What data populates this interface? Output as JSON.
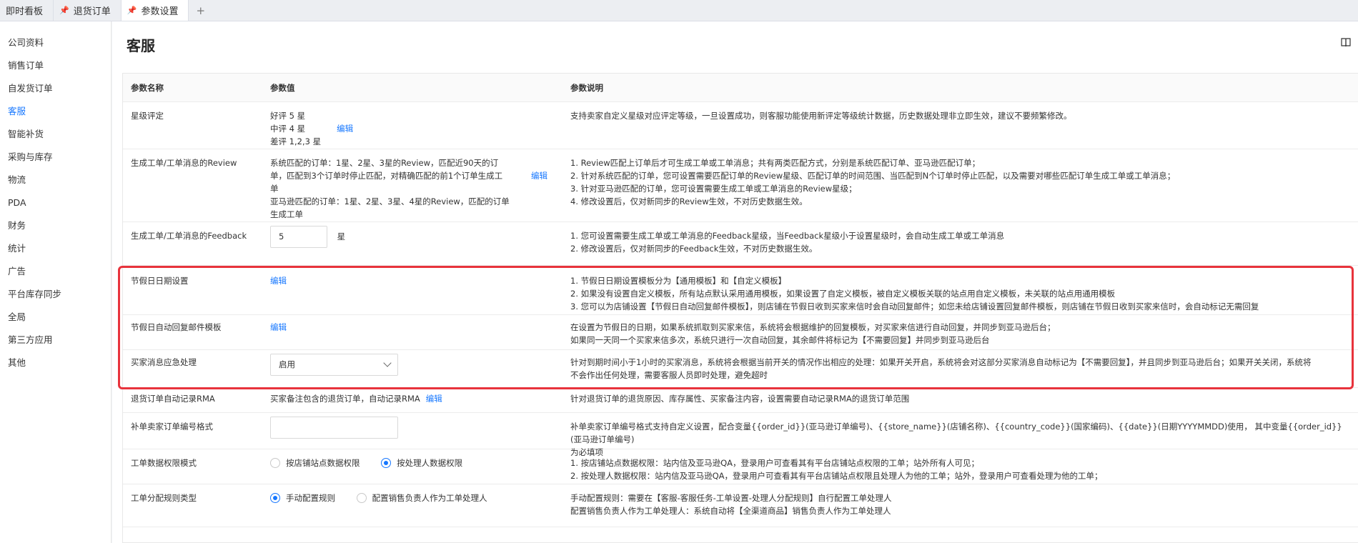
{
  "tabs": [
    {
      "label": "即时看板",
      "pinned": false,
      "active": false
    },
    {
      "label": "退货订单",
      "pinned": true,
      "active": false
    },
    {
      "label": "参数设置",
      "pinned": true,
      "active": true
    }
  ],
  "tab_add": "+",
  "sidebar": {
    "items": [
      {
        "label": "公司资料"
      },
      {
        "label": "销售订单"
      },
      {
        "label": "自发货订单"
      },
      {
        "label": "客服",
        "active": true
      },
      {
        "label": "智能补货"
      },
      {
        "label": "采购与库存"
      },
      {
        "label": "物流"
      },
      {
        "label": "PDA"
      },
      {
        "label": "财务"
      },
      {
        "label": "统计"
      },
      {
        "label": "广告"
      },
      {
        "label": "平台库存同步"
      },
      {
        "label": "全局"
      },
      {
        "label": "第三方应用"
      },
      {
        "label": "其他"
      }
    ]
  },
  "page": {
    "title": "客服"
  },
  "table": {
    "headers": {
      "name": "参数名称",
      "value": "参数值",
      "desc": "参数说明"
    },
    "rows": {
      "r1": {
        "name": "星级评定",
        "value_lines": [
          "好评 5 星",
          "中评 4 星",
          "差评 1,2,3 星"
        ],
        "link": "编辑",
        "desc": "支持卖家自定义星级对应评定等级，一旦设置成功，则客服功能使用新评定等级统计数据，历史数据处理非立即生效，建议不要频繁修改。"
      },
      "r2": {
        "name": "生成工单/工单消息的Review",
        "value_lines": [
          "系统匹配的订单：1星、2星、3星的Review，匹配近90天的订",
          "单，匹配到3个订单时停止匹配，对精确匹配的前1个订单生成工",
          "单",
          "亚马逊匹配的订单：1星、2星、3星、4星的Review，匹配的订单",
          "生成工单"
        ],
        "link": "编辑",
        "desc_lines": [
          "1. Review匹配上订单后才可生成工单或工单消息；共有两类匹配方式，分别是系统匹配订单、亚马逊匹配订单；",
          "2. 针对系统匹配的订单，您可设置需要匹配订单的Review星级、匹配订单的时间范围、当匹配到N个订单时停止匹配，以及需要对哪些匹配订单生成工单或工单消息；",
          "3. 针对亚马逊匹配的订单，您可设置需要生成工单或工单消息的Review星级；",
          "4. 修改设置后，仅对新同步的Review生效，不对历史数据生效。"
        ]
      },
      "r3": {
        "name": "生成工单/工单消息的Feedback",
        "input_value": "5",
        "unit": "星",
        "desc_lines": [
          "1. 您可设置需要生成工单或工单消息的Feedback星级，当Feedback星级小于设置星级时，会自动生成工单或工单消息",
          "2. 修改设置后，仅对新同步的Feedback生效，不对历史数据生效。"
        ]
      },
      "r4": {
        "name": "节假日日期设置",
        "link": "编辑",
        "desc_lines": [
          "1. 节假日日期设置模板分为【通用模板】和【自定义模板】",
          "2. 如果没有设置自定义模板，所有站点默认采用通用模板，如果设置了自定义模板，被自定义模板关联的站点用自定义模板，未关联的站点用通用模板",
          "3. 您可以为店铺设置【节假日自动回复邮件模板】，则店铺在节假日收到买家来信时会自动回复邮件；如您未给店铺设置回复邮件模板，则店铺在节假日收到买家来信时，会自动标记无需回复"
        ]
      },
      "r5": {
        "name": "节假日自动回复邮件模板",
        "link": "编辑",
        "desc_lines": [
          "在设置为节假日的日期，如果系统抓取到买家来信，系统将会根据维护的回复模板，对买家来信进行自动回复，并同步到亚马逊后台；",
          "如果同一天同一个买家来信多次，系统只进行一次自动回复，其余邮件将标记为【不需要回复】并同步到亚马逊后台"
        ]
      },
      "r6": {
        "name": "买家消息应急处理",
        "select_value": "启用",
        "desc_lines": [
          "针对到期时间小于1小时的买家消息，系统将会根据当前开关的情况作出相应的处理：如果开关开启，系统将会对这部分买家消息自动标记为【不需要回复】，并且同步到亚马逊后台；如果开关关闭，系统将",
          "不会作出任何处理，需要客服人员即时处理，避免超时"
        ]
      },
      "r7": {
        "name": "退货订单自动记录RMA",
        "value_text": "买家备注包含的退货订单，自动记录RMA",
        "link": "编辑",
        "desc": "针对退货订单的退货原因、库存属性、买家备注内容，设置需要自动记录RMA的退货订单范围"
      },
      "r8": {
        "name": "补单卖家订单编号格式",
        "input_value": "",
        "desc_lines": [
          "补单卖家订单编号格式支持自定义设置，配合变量{{order_id}}(亚马逊订单编号)、{{store_name}}(店铺名称)、{{country_code}}(国家编码)、{{date}}(日期YYYYMMDD)使用， 其中变量{{order_id}}(亚马逊订单编号)",
          "为必填项"
        ]
      },
      "r9": {
        "name": "工单数据权限模式",
        "options": [
          {
            "label": "按店铺站点数据权限",
            "checked": false
          },
          {
            "label": "按处理人数据权限",
            "checked": true
          }
        ],
        "desc_lines": [
          "1. 按店铺站点数据权限：站内信及亚马逊QA，登录用户可查看其有平台店铺站点权限的工单；站外所有人可见；",
          "2. 按处理人数据权限：站内信及亚马逊QA，登录用户可查看其有平台店铺站点权限且处理人为他的工单；站外，登录用户可查看处理为他的工单；"
        ]
      },
      "r10": {
        "name": "工单分配规则类型",
        "options": [
          {
            "label": "手动配置规则",
            "checked": true
          },
          {
            "label": "配置销售负责人作为工单处理人",
            "checked": false
          }
        ],
        "desc_lines": [
          "手动配置规则：需要在【客服-客服任务-工单设置-处理人分配规则】自行配置工单处理人",
          "配置销售负责人作为工单处理人：系统自动将【全渠道商品】销售负责人作为工单处理人"
        ]
      }
    }
  },
  "colors": {
    "accent": "#1677ff",
    "highlight": "#e8333c"
  }
}
